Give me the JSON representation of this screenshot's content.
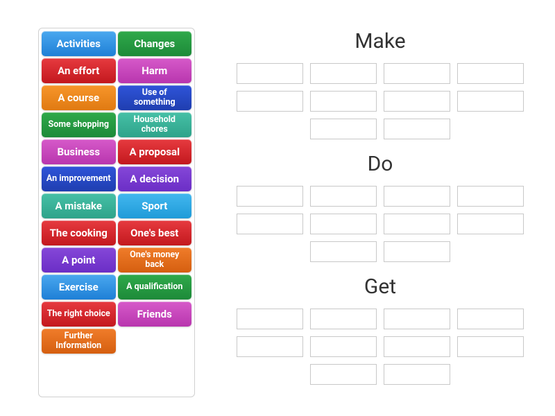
{
  "tiles": [
    {
      "label": "Activities",
      "color": "c-blue",
      "small": false
    },
    {
      "label": "Changes",
      "color": "c-green",
      "small": false
    },
    {
      "label": "An effort",
      "color": "c-red",
      "small": false
    },
    {
      "label": "Harm",
      "color": "c-pink",
      "small": false
    },
    {
      "label": "A course",
      "color": "c-orange",
      "small": false
    },
    {
      "label": "Use of something",
      "color": "c-dblue",
      "small": true
    },
    {
      "label": "Some shopping",
      "color": "c-green",
      "small": true
    },
    {
      "label": "Household chores",
      "color": "c-teal",
      "small": true
    },
    {
      "label": "Business",
      "color": "c-pink",
      "small": false
    },
    {
      "label": "A proposal",
      "color": "c-red",
      "small": false
    },
    {
      "label": "An improvement",
      "color": "c-dblue",
      "small": true
    },
    {
      "label": "A decision",
      "color": "c-purple",
      "small": false
    },
    {
      "label": "A mistake",
      "color": "c-teal",
      "small": false
    },
    {
      "label": "Sport",
      "color": "c-lblue",
      "small": false
    },
    {
      "label": "The cooking",
      "color": "c-red",
      "small": false
    },
    {
      "label": "One's best",
      "color": "c-red",
      "small": false
    },
    {
      "label": "A point",
      "color": "c-purple",
      "small": false
    },
    {
      "label": "One's money back",
      "color": "c-orange2",
      "small": true
    },
    {
      "label": "Exercise",
      "color": "c-blue",
      "small": false
    },
    {
      "label": "A qualification",
      "color": "c-green",
      "small": true
    },
    {
      "label": "The right choice",
      "color": "c-red",
      "small": true
    },
    {
      "label": "Friends",
      "color": "c-pink",
      "small": false
    },
    {
      "label": "Further Information",
      "color": "c-orange2",
      "small": true,
      "full": true
    }
  ],
  "groups": [
    {
      "title": "Make",
      "slots": 10
    },
    {
      "title": "Do",
      "slots": 10
    },
    {
      "title": "Get",
      "slots": 10
    }
  ]
}
